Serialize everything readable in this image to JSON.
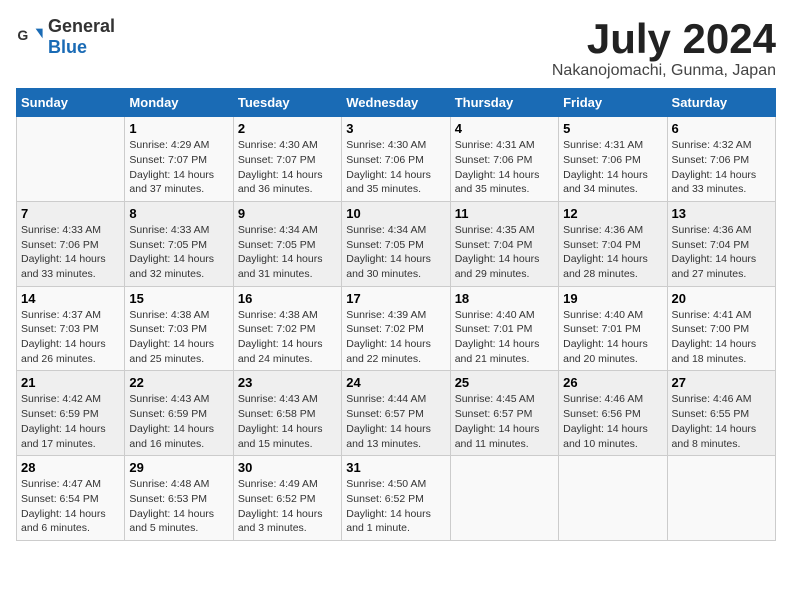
{
  "header": {
    "logo_general": "General",
    "logo_blue": "Blue",
    "month_title": "July 2024",
    "location": "Nakanojomachi, Gunma, Japan"
  },
  "weekdays": [
    "Sunday",
    "Monday",
    "Tuesday",
    "Wednesday",
    "Thursday",
    "Friday",
    "Saturday"
  ],
  "weeks": [
    [
      {
        "day": "",
        "info": ""
      },
      {
        "day": "1",
        "info": "Sunrise: 4:29 AM\nSunset: 7:07 PM\nDaylight: 14 hours\nand 37 minutes."
      },
      {
        "day": "2",
        "info": "Sunrise: 4:30 AM\nSunset: 7:07 PM\nDaylight: 14 hours\nand 36 minutes."
      },
      {
        "day": "3",
        "info": "Sunrise: 4:30 AM\nSunset: 7:06 PM\nDaylight: 14 hours\nand 35 minutes."
      },
      {
        "day": "4",
        "info": "Sunrise: 4:31 AM\nSunset: 7:06 PM\nDaylight: 14 hours\nand 35 minutes."
      },
      {
        "day": "5",
        "info": "Sunrise: 4:31 AM\nSunset: 7:06 PM\nDaylight: 14 hours\nand 34 minutes."
      },
      {
        "day": "6",
        "info": "Sunrise: 4:32 AM\nSunset: 7:06 PM\nDaylight: 14 hours\nand 33 minutes."
      }
    ],
    [
      {
        "day": "7",
        "info": "Sunrise: 4:33 AM\nSunset: 7:06 PM\nDaylight: 14 hours\nand 33 minutes."
      },
      {
        "day": "8",
        "info": "Sunrise: 4:33 AM\nSunset: 7:05 PM\nDaylight: 14 hours\nand 32 minutes."
      },
      {
        "day": "9",
        "info": "Sunrise: 4:34 AM\nSunset: 7:05 PM\nDaylight: 14 hours\nand 31 minutes."
      },
      {
        "day": "10",
        "info": "Sunrise: 4:34 AM\nSunset: 7:05 PM\nDaylight: 14 hours\nand 30 minutes."
      },
      {
        "day": "11",
        "info": "Sunrise: 4:35 AM\nSunset: 7:04 PM\nDaylight: 14 hours\nand 29 minutes."
      },
      {
        "day": "12",
        "info": "Sunrise: 4:36 AM\nSunset: 7:04 PM\nDaylight: 14 hours\nand 28 minutes."
      },
      {
        "day": "13",
        "info": "Sunrise: 4:36 AM\nSunset: 7:04 PM\nDaylight: 14 hours\nand 27 minutes."
      }
    ],
    [
      {
        "day": "14",
        "info": "Sunrise: 4:37 AM\nSunset: 7:03 PM\nDaylight: 14 hours\nand 26 minutes."
      },
      {
        "day": "15",
        "info": "Sunrise: 4:38 AM\nSunset: 7:03 PM\nDaylight: 14 hours\nand 25 minutes."
      },
      {
        "day": "16",
        "info": "Sunrise: 4:38 AM\nSunset: 7:02 PM\nDaylight: 14 hours\nand 24 minutes."
      },
      {
        "day": "17",
        "info": "Sunrise: 4:39 AM\nSunset: 7:02 PM\nDaylight: 14 hours\nand 22 minutes."
      },
      {
        "day": "18",
        "info": "Sunrise: 4:40 AM\nSunset: 7:01 PM\nDaylight: 14 hours\nand 21 minutes."
      },
      {
        "day": "19",
        "info": "Sunrise: 4:40 AM\nSunset: 7:01 PM\nDaylight: 14 hours\nand 20 minutes."
      },
      {
        "day": "20",
        "info": "Sunrise: 4:41 AM\nSunset: 7:00 PM\nDaylight: 14 hours\nand 18 minutes."
      }
    ],
    [
      {
        "day": "21",
        "info": "Sunrise: 4:42 AM\nSunset: 6:59 PM\nDaylight: 14 hours\nand 17 minutes."
      },
      {
        "day": "22",
        "info": "Sunrise: 4:43 AM\nSunset: 6:59 PM\nDaylight: 14 hours\nand 16 minutes."
      },
      {
        "day": "23",
        "info": "Sunrise: 4:43 AM\nSunset: 6:58 PM\nDaylight: 14 hours\nand 15 minutes."
      },
      {
        "day": "24",
        "info": "Sunrise: 4:44 AM\nSunset: 6:57 PM\nDaylight: 14 hours\nand 13 minutes."
      },
      {
        "day": "25",
        "info": "Sunrise: 4:45 AM\nSunset: 6:57 PM\nDaylight: 14 hours\nand 11 minutes."
      },
      {
        "day": "26",
        "info": "Sunrise: 4:46 AM\nSunset: 6:56 PM\nDaylight: 14 hours\nand 10 minutes."
      },
      {
        "day": "27",
        "info": "Sunrise: 4:46 AM\nSunset: 6:55 PM\nDaylight: 14 hours\nand 8 minutes."
      }
    ],
    [
      {
        "day": "28",
        "info": "Sunrise: 4:47 AM\nSunset: 6:54 PM\nDaylight: 14 hours\nand 6 minutes."
      },
      {
        "day": "29",
        "info": "Sunrise: 4:48 AM\nSunset: 6:53 PM\nDaylight: 14 hours\nand 5 minutes."
      },
      {
        "day": "30",
        "info": "Sunrise: 4:49 AM\nSunset: 6:52 PM\nDaylight: 14 hours\nand 3 minutes."
      },
      {
        "day": "31",
        "info": "Sunrise: 4:50 AM\nSunset: 6:52 PM\nDaylight: 14 hours\nand 1 minute."
      },
      {
        "day": "",
        "info": ""
      },
      {
        "day": "",
        "info": ""
      },
      {
        "day": "",
        "info": ""
      }
    ]
  ]
}
